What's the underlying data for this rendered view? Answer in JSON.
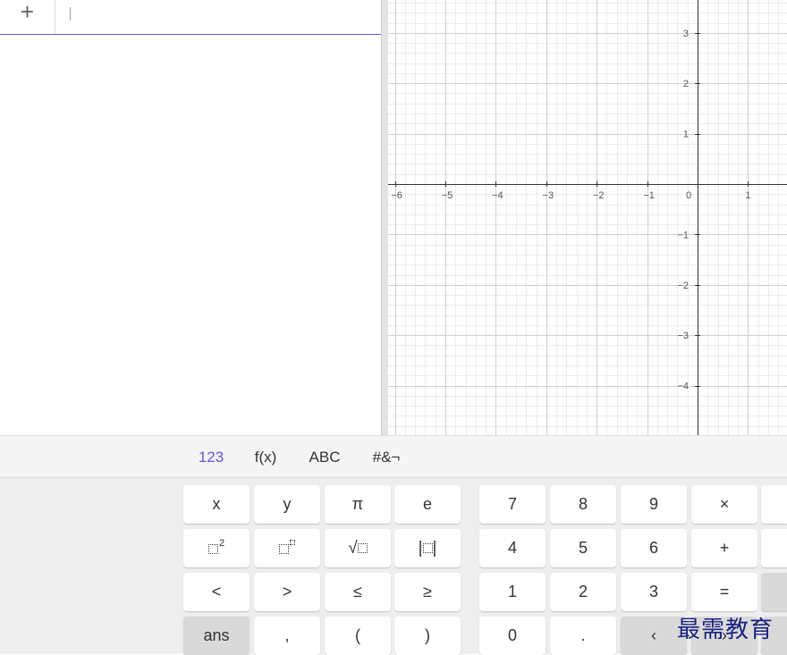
{
  "algebra": {
    "add_label": "+"
  },
  "graph": {
    "x_ticks": [
      "−6",
      "−5",
      "−4",
      "−3",
      "−2",
      "−1",
      "0",
      "1"
    ],
    "y_ticks": [
      "3",
      "2",
      "1",
      "−1",
      "−2",
      "−3",
      "−4"
    ]
  },
  "keyboard": {
    "tabs": [
      {
        "label": "123",
        "active": true
      },
      {
        "label": "f(x)",
        "active": false
      },
      {
        "label": "ABC",
        "active": false
      },
      {
        "label": "#&¬",
        "active": false
      }
    ],
    "rows": [
      {
        "left": [
          "x",
          "y",
          "π",
          "e"
        ],
        "right": [
          "7",
          "8",
          "9",
          "×"
        ]
      },
      {
        "left": [
          "square-icon",
          "power-icon",
          "sqrt-icon",
          "abs-icon"
        ],
        "right": [
          "4",
          "5",
          "6",
          "+"
        ]
      },
      {
        "left": [
          "<",
          ">",
          "≤",
          "≥"
        ],
        "right": [
          "1",
          "2",
          "3",
          "="
        ]
      },
      {
        "left": [
          "ans",
          ",",
          "(",
          ")"
        ],
        "right": [
          "0",
          ".",
          "‹",
          "›"
        ]
      }
    ]
  },
  "watermark": "最需教育",
  "colors": {
    "accent": "#6557d2",
    "axis": "#333333",
    "key_bg": "#ffffff",
    "key_grey": "#d9d9d9",
    "keyboard_bg": "#eeeeee"
  }
}
